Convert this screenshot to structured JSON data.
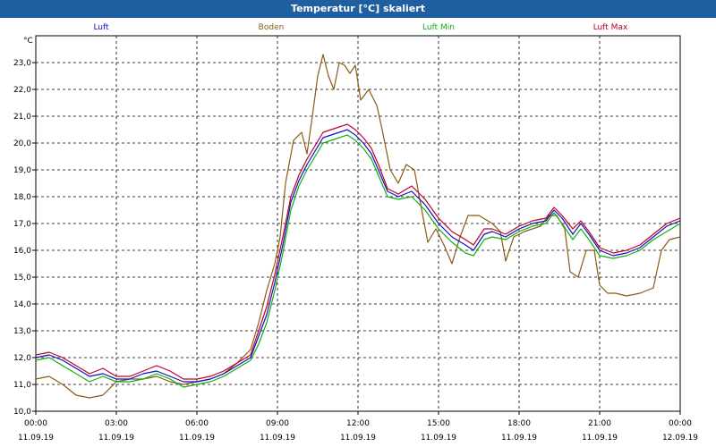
{
  "window": {
    "title": "Temperatur [°C] skaliert"
  },
  "chart_data": {
    "type": "line",
    "title": "Temperatur [°C] skaliert",
    "ylabel": "°C",
    "ylim": [
      10,
      24
    ],
    "yticks": [
      "10,0",
      "11,0",
      "12,0",
      "13,0",
      "14,0",
      "15,0",
      "16,0",
      "17,0",
      "18,0",
      "19,0",
      "20,0",
      "21,0",
      "22,0",
      "23,0"
    ],
    "xlim": [
      0,
      24
    ],
    "xticks": [
      {
        "time": "00:00",
        "date": "11.09.19"
      },
      {
        "time": "03:00",
        "date": "11.09.19"
      },
      {
        "time": "06:00",
        "date": "11.09.19"
      },
      {
        "time": "09:00",
        "date": "11.09.19"
      },
      {
        "time": "12:00",
        "date": "11.09.19"
      },
      {
        "time": "15:00",
        "date": "11.09.19"
      },
      {
        "time": "18:00",
        "date": "11.09.19"
      },
      {
        "time": "21:00",
        "date": "11.09.19"
      },
      {
        "time": "00:00",
        "date": "12.09.19"
      }
    ],
    "grid": true,
    "legend_position": "top",
    "series": [
      {
        "name": "Luft",
        "color": "#1010c0",
        "points": [
          [
            0,
            12.0
          ],
          [
            0.5,
            12.1
          ],
          [
            1,
            11.9
          ],
          [
            1.5,
            11.6
          ],
          [
            2,
            11.3
          ],
          [
            2.5,
            11.4
          ],
          [
            3,
            11.2
          ],
          [
            3.5,
            11.2
          ],
          [
            4,
            11.4
          ],
          [
            4.5,
            11.5
          ],
          [
            5,
            11.3
          ],
          [
            5.5,
            11.1
          ],
          [
            6,
            11.1
          ],
          [
            6.5,
            11.2
          ],
          [
            7,
            11.4
          ],
          [
            7.5,
            11.7
          ],
          [
            8,
            12.0
          ],
          [
            8.3,
            12.8
          ],
          [
            8.6,
            13.6
          ],
          [
            8.9,
            14.8
          ],
          [
            9.2,
            16.2
          ],
          [
            9.5,
            17.8
          ],
          [
            9.8,
            18.6
          ],
          [
            10.1,
            19.2
          ],
          [
            10.4,
            19.7
          ],
          [
            10.7,
            20.2
          ],
          [
            11.0,
            20.3
          ],
          [
            11.3,
            20.4
          ],
          [
            11.6,
            20.5
          ],
          [
            11.9,
            20.3
          ],
          [
            12.2,
            20.0
          ],
          [
            12.5,
            19.6
          ],
          [
            12.8,
            18.9
          ],
          [
            13.1,
            18.2
          ],
          [
            13.5,
            18.0
          ],
          [
            14,
            18.2
          ],
          [
            14.5,
            17.7
          ],
          [
            15,
            17.0
          ],
          [
            15.5,
            16.5
          ],
          [
            16,
            16.2
          ],
          [
            16.3,
            16.0
          ],
          [
            16.7,
            16.6
          ],
          [
            17,
            16.7
          ],
          [
            17.5,
            16.5
          ],
          [
            18,
            16.8
          ],
          [
            18.5,
            17.0
          ],
          [
            19,
            17.1
          ],
          [
            19.3,
            17.5
          ],
          [
            19.6,
            17.2
          ],
          [
            20,
            16.6
          ],
          [
            20.3,
            17.0
          ],
          [
            20.6,
            16.6
          ],
          [
            21,
            16.0
          ],
          [
            21.5,
            15.8
          ],
          [
            22,
            15.9
          ],
          [
            22.5,
            16.1
          ],
          [
            23,
            16.5
          ],
          [
            23.5,
            16.9
          ],
          [
            24,
            17.1
          ]
        ]
      },
      {
        "name": "Boden",
        "color": "#8b5a14",
        "points": [
          [
            0,
            11.2
          ],
          [
            0.5,
            11.3
          ],
          [
            1,
            11.0
          ],
          [
            1.5,
            10.6
          ],
          [
            2,
            10.5
          ],
          [
            2.5,
            10.6
          ],
          [
            3,
            11.1
          ],
          [
            3.5,
            11.2
          ],
          [
            4,
            11.2
          ],
          [
            4.5,
            11.3
          ],
          [
            5,
            11.1
          ],
          [
            5.5,
            11.0
          ],
          [
            6,
            11.1
          ],
          [
            6.5,
            11.2
          ],
          [
            7,
            11.4
          ],
          [
            7.5,
            11.8
          ],
          [
            8,
            12.3
          ],
          [
            8.3,
            13.3
          ],
          [
            8.6,
            14.5
          ],
          [
            8.9,
            15.5
          ],
          [
            9.1,
            16.5
          ],
          [
            9.3,
            18.5
          ],
          [
            9.6,
            20.1
          ],
          [
            9.9,
            20.4
          ],
          [
            10.1,
            19.6
          ],
          [
            10.3,
            21.0
          ],
          [
            10.5,
            22.5
          ],
          [
            10.7,
            23.3
          ],
          [
            10.9,
            22.5
          ],
          [
            11.1,
            22.0
          ],
          [
            11.3,
            23.0
          ],
          [
            11.5,
            22.9
          ],
          [
            11.7,
            22.6
          ],
          [
            11.9,
            22.9
          ],
          [
            12.1,
            21.6
          ],
          [
            12.4,
            22.0
          ],
          [
            12.7,
            21.4
          ],
          [
            12.9,
            20.5
          ],
          [
            13.2,
            19.0
          ],
          [
            13.5,
            18.5
          ],
          [
            13.8,
            19.2
          ],
          [
            14.1,
            19.0
          ],
          [
            14.3,
            17.9
          ],
          [
            14.6,
            16.3
          ],
          [
            14.9,
            16.8
          ],
          [
            15.2,
            16.2
          ],
          [
            15.5,
            15.5
          ],
          [
            15.8,
            16.5
          ],
          [
            16.1,
            17.3
          ],
          [
            16.5,
            17.3
          ],
          [
            17,
            17.0
          ],
          [
            17.3,
            16.7
          ],
          [
            17.5,
            15.6
          ],
          [
            17.8,
            16.5
          ],
          [
            18.2,
            16.7
          ],
          [
            18.5,
            16.8
          ],
          [
            18.8,
            16.9
          ],
          [
            19.1,
            17.3
          ],
          [
            19.4,
            17.3
          ],
          [
            19.7,
            16.8
          ],
          [
            19.9,
            15.2
          ],
          [
            20.2,
            15.0
          ],
          [
            20.5,
            16.0
          ],
          [
            20.8,
            16.0
          ],
          [
            21,
            14.7
          ],
          [
            21.3,
            14.4
          ],
          [
            21.6,
            14.4
          ],
          [
            22,
            14.3
          ],
          [
            22.5,
            14.4
          ],
          [
            23,
            14.6
          ],
          [
            23.3,
            16.0
          ],
          [
            23.6,
            16.4
          ],
          [
            24,
            16.5
          ]
        ]
      },
      {
        "name": "Luft Min",
        "color": "#10b010",
        "points": [
          [
            0,
            11.9
          ],
          [
            0.5,
            12.0
          ],
          [
            1,
            11.7
          ],
          [
            1.5,
            11.4
          ],
          [
            2,
            11.1
          ],
          [
            2.5,
            11.3
          ],
          [
            3,
            11.1
          ],
          [
            3.5,
            11.1
          ],
          [
            4,
            11.2
          ],
          [
            4.5,
            11.4
          ],
          [
            5,
            11.2
          ],
          [
            5.5,
            10.9
          ],
          [
            6,
            11.0
          ],
          [
            6.5,
            11.1
          ],
          [
            7,
            11.3
          ],
          [
            7.5,
            11.6
          ],
          [
            8,
            11.9
          ],
          [
            8.3,
            12.5
          ],
          [
            8.6,
            13.3
          ],
          [
            8.9,
            14.5
          ],
          [
            9.2,
            15.9
          ],
          [
            9.5,
            17.5
          ],
          [
            9.8,
            18.4
          ],
          [
            10.1,
            19.0
          ],
          [
            10.4,
            19.5
          ],
          [
            10.7,
            20.0
          ],
          [
            11.0,
            20.1
          ],
          [
            11.3,
            20.2
          ],
          [
            11.6,
            20.3
          ],
          [
            11.9,
            20.1
          ],
          [
            12.2,
            19.8
          ],
          [
            12.5,
            19.4
          ],
          [
            12.8,
            18.7
          ],
          [
            13.1,
            18.0
          ],
          [
            13.5,
            17.9
          ],
          [
            14,
            18.0
          ],
          [
            14.5,
            17.5
          ],
          [
            15,
            16.8
          ],
          [
            15.5,
            16.3
          ],
          [
            16,
            15.9
          ],
          [
            16.3,
            15.8
          ],
          [
            16.7,
            16.4
          ],
          [
            17,
            16.5
          ],
          [
            17.5,
            16.4
          ],
          [
            18,
            16.7
          ],
          [
            18.5,
            16.9
          ],
          [
            19,
            17.0
          ],
          [
            19.3,
            17.4
          ],
          [
            19.6,
            17.0
          ],
          [
            20,
            16.4
          ],
          [
            20.3,
            16.8
          ],
          [
            20.6,
            16.4
          ],
          [
            21,
            15.8
          ],
          [
            21.5,
            15.7
          ],
          [
            22,
            15.8
          ],
          [
            22.5,
            16.0
          ],
          [
            23,
            16.4
          ],
          [
            23.5,
            16.7
          ],
          [
            24,
            17.0
          ]
        ]
      },
      {
        "name": "Luft Max",
        "color": "#c00028",
        "points": [
          [
            0,
            12.1
          ],
          [
            0.5,
            12.2
          ],
          [
            1,
            12.0
          ],
          [
            1.5,
            11.7
          ],
          [
            2,
            11.4
          ],
          [
            2.5,
            11.6
          ],
          [
            3,
            11.3
          ],
          [
            3.5,
            11.3
          ],
          [
            4,
            11.5
          ],
          [
            4.5,
            11.7
          ],
          [
            5,
            11.5
          ],
          [
            5.5,
            11.2
          ],
          [
            6,
            11.2
          ],
          [
            6.5,
            11.3
          ],
          [
            7,
            11.5
          ],
          [
            7.5,
            11.8
          ],
          [
            8,
            12.1
          ],
          [
            8.3,
            13.0
          ],
          [
            8.6,
            13.9
          ],
          [
            8.9,
            15.1
          ],
          [
            9.2,
            16.5
          ],
          [
            9.5,
            18.0
          ],
          [
            9.8,
            18.8
          ],
          [
            10.1,
            19.4
          ],
          [
            10.4,
            19.9
          ],
          [
            10.7,
            20.4
          ],
          [
            11.0,
            20.5
          ],
          [
            11.3,
            20.6
          ],
          [
            11.6,
            20.7
          ],
          [
            11.9,
            20.5
          ],
          [
            12.2,
            20.2
          ],
          [
            12.5,
            19.8
          ],
          [
            12.8,
            19.1
          ],
          [
            13.1,
            18.3
          ],
          [
            13.5,
            18.1
          ],
          [
            14,
            18.4
          ],
          [
            14.5,
            17.9
          ],
          [
            15,
            17.2
          ],
          [
            15.5,
            16.7
          ],
          [
            16,
            16.4
          ],
          [
            16.3,
            16.2
          ],
          [
            16.7,
            16.8
          ],
          [
            17,
            16.8
          ],
          [
            17.5,
            16.6
          ],
          [
            18,
            16.9
          ],
          [
            18.5,
            17.1
          ],
          [
            19,
            17.2
          ],
          [
            19.3,
            17.6
          ],
          [
            19.6,
            17.3
          ],
          [
            20,
            16.8
          ],
          [
            20.3,
            17.1
          ],
          [
            20.6,
            16.7
          ],
          [
            21,
            16.1
          ],
          [
            21.5,
            15.9
          ],
          [
            22,
            16.0
          ],
          [
            22.5,
            16.2
          ],
          [
            23,
            16.6
          ],
          [
            23.5,
            17.0
          ],
          [
            24,
            17.2
          ]
        ]
      }
    ]
  }
}
